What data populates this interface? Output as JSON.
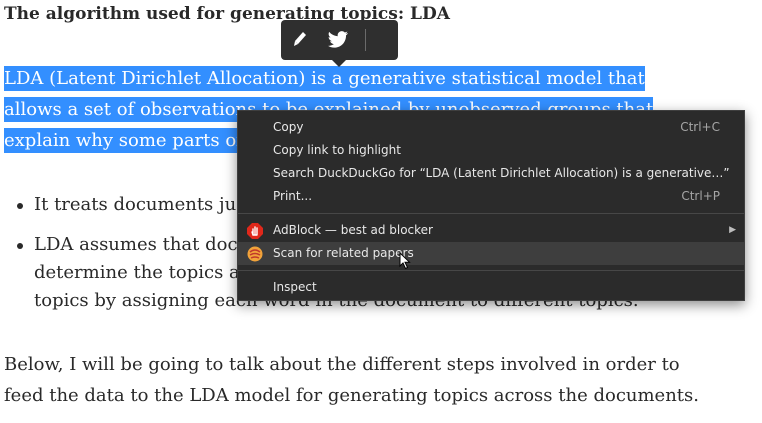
{
  "article": {
    "heading": "The algorithm used for generating topics: LDA",
    "highlighted_paragraph": "LDA (Latent Dirichlet Allocation) is a generative statistical model that allows a set of observations to be explained by unobserved groups that explain why some parts of the data are",
    "bullets": [
      "It treats documents jus",
      "LDA assumes that docu",
      "determine the topics ar",
      "topics by assigning each word in the document to different topics."
    ],
    "below_paragraph": "Below, I will be going to talk about the different steps involved in order to feed the data to the LDA model for generating topics across the documents."
  },
  "highlight_toolbar": {
    "icons": [
      "highlighter-pen-icon",
      "twitter-icon"
    ]
  },
  "context_menu": {
    "copy": {
      "label": "Copy",
      "shortcut": "Ctrl+C"
    },
    "copy_link": {
      "label": "Copy link to highlight"
    },
    "search": {
      "label": "Search DuckDuckGo for “LDA (Latent Dirichlet Allocation) is a generative…”"
    },
    "print": {
      "label": "Print...",
      "shortcut": "Ctrl+P"
    },
    "adblock": {
      "label": "AdBlock — best ad blocker",
      "icon": "adblock-hand-icon",
      "color": "#e0281b"
    },
    "scan": {
      "label": "Scan for related papers",
      "icon": "scan-papers-icon",
      "color": "#f2a33a"
    },
    "inspect": {
      "label": "Inspect"
    }
  },
  "colors": {
    "selection": "#338fff",
    "menu_bg": "#2b2b2b",
    "toolbar_bg": "#2f2f2f"
  }
}
